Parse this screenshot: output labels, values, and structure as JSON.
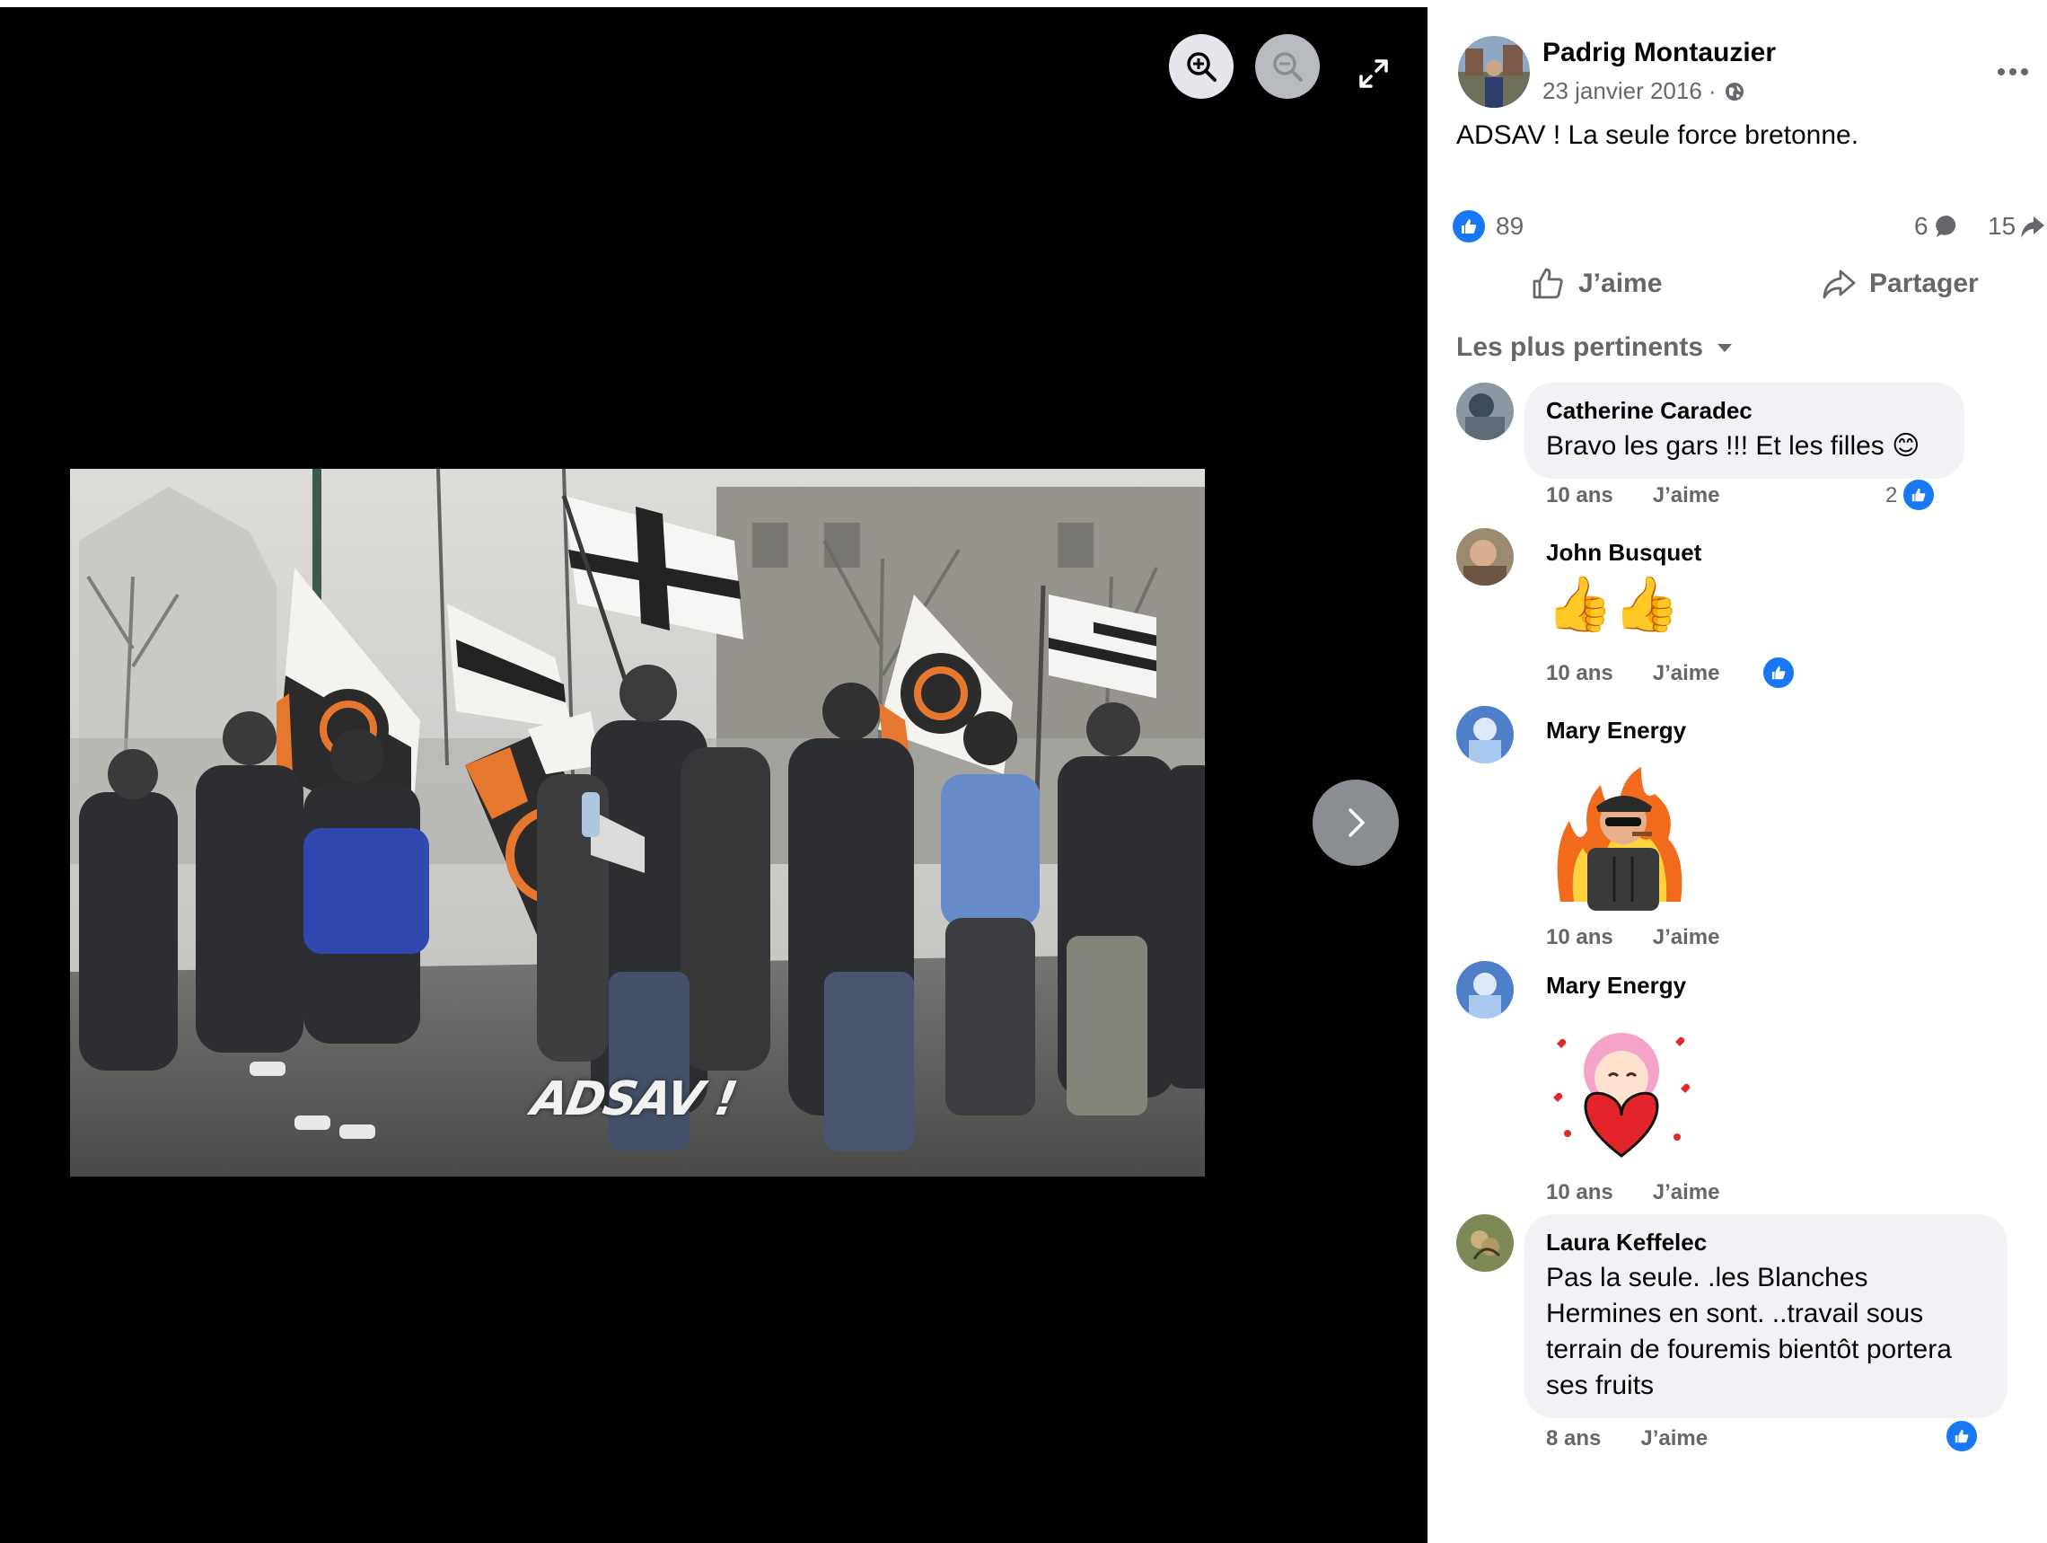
{
  "viewer": {
    "zoom_in_icon": "zoom-in-icon",
    "zoom_out_icon": "zoom-out-icon",
    "fullscreen_icon": "expand-icon",
    "next_icon": "chevron-right-icon",
    "photo_caption": "ADSAV !"
  },
  "post": {
    "author": "Padrig Montauzier",
    "date": "23 janvier 2016 ·",
    "privacy_icon": "globe-icon",
    "text": "ADSAV ! La seule force bretonne.",
    "reactions": "89",
    "comments": "6",
    "shares": "15"
  },
  "actions": {
    "like": "J’aime",
    "share": "Partager"
  },
  "sort": {
    "label": "Les plus pertinents"
  },
  "comments": [
    {
      "name": "Catherine Caradec",
      "text": "Bravo les gars !!! Et les filles 😊",
      "age": "10 ans",
      "like": "J’aime",
      "reaction_count": "2"
    },
    {
      "name": "John Busquet",
      "text": "👍👍",
      "age": "10 ans",
      "like": "J’aime"
    },
    {
      "name": "Mary Energy",
      "sticker": "soldier-sticker",
      "age": "10 ans",
      "like": "J’aime"
    },
    {
      "name": "Mary Energy",
      "sticker": "heart-girl-sticker",
      "age": "10 ans",
      "like": "J’aime"
    },
    {
      "name": "Laura Keffelec",
      "lines": [
        "Pas la seule. .les Blanches",
        "Hermines en sont. ..travail sous",
        "terrain de fouremis bientôt portera",
        "ses fruits"
      ],
      "age": "8 ans",
      "like": "J’aime"
    }
  ],
  "colors": {
    "brand": "#1877f2",
    "muted": "#65676b",
    "bubble": "#f0f2f5",
    "viewer_bg": "#000000"
  }
}
